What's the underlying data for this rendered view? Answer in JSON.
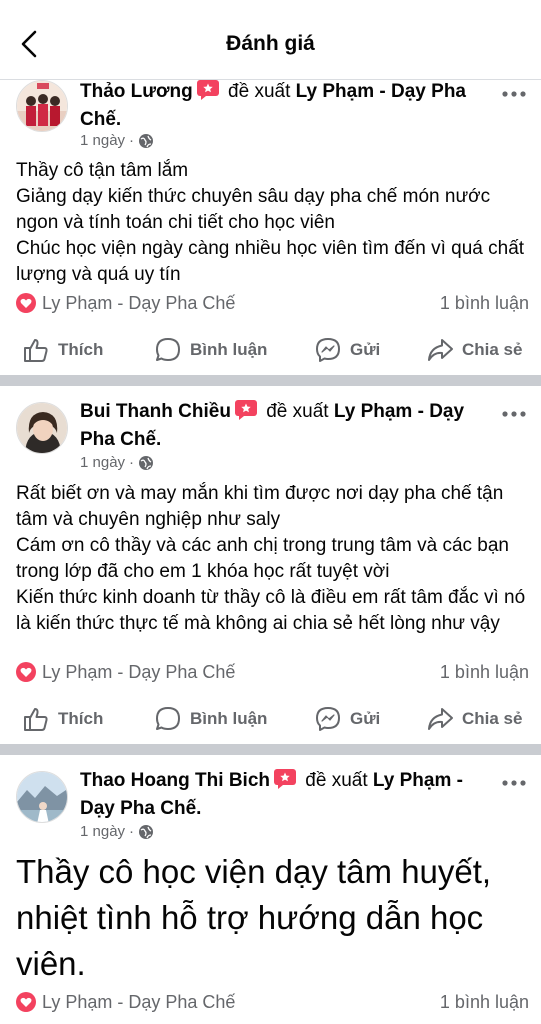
{
  "header": {
    "title": "Đánh giá"
  },
  "posts": [
    {
      "name": "Thảo Lương",
      "recommend_word": "đề xuất",
      "page": "Ly Phạm - Dạy Pha Chế.",
      "time": "1 ngày",
      "sep": "·",
      "text": "Thầy cô tận tâm lắm\nGiảng dạy kiến thức chuyên sâu dạy pha chế món nước ngon và tính toán chi tiết cho học viên\nChúc học viện ngày càng nhiều học viên tìm đến vì quá chất lượng và quá uy tín",
      "footer_page": "Ly Phạm - Dạy Pha Chế",
      "comments": "1 bình luận"
    },
    {
      "name": "Bui Thanh Chiều",
      "recommend_word": "đề xuất",
      "page": "Ly Phạm - Dạy Pha Chế.",
      "time": "1 ngày",
      "sep": "·",
      "text": "Rất biết ơn và may mắn khi tìm được nơi dạy pha chế tận tâm và chuyên nghiệp như saly\nCám ơn cô thầy và các anh chị trong trung tâm và các bạn trong lớp đã cho em 1 khóa học rất tuyệt vời\nKiến thức kinh doanh từ thầy cô là điều em rất tâm đắc vì nó là kiến thức thực tế mà không ai chia sẻ hết lòng như vậy",
      "footer_page": "Ly Phạm - Dạy Pha Chế",
      "comments": "1 bình luận"
    },
    {
      "name": "Thao Hoang Thi Bich",
      "recommend_word": "đề xuất",
      "page": "Ly Phạm - Dạy Pha Chế.",
      "time": "1 ngày",
      "sep": "·",
      "text": "Thầy cô học viện dạy tâm huyết, nhiệt tình hỗ trợ hướng dẫn học viên.",
      "footer_page": "Ly Phạm - Dạy Pha Chế",
      "comments": "1 bình luận"
    }
  ],
  "actions": {
    "like": "Thích",
    "comment": "Bình luận",
    "send": "Gửi",
    "share": "Chia sẻ"
  },
  "icons": [
    "back-arrow-icon",
    "recommend-flag-icon",
    "globe-icon",
    "more-icon",
    "heart-icon",
    "like-icon",
    "comment-icon",
    "messenger-icon",
    "share-icon"
  ],
  "colors": {
    "recommend": "#f3425f",
    "muted": "#65676b",
    "divider": "#c9ccd1"
  }
}
